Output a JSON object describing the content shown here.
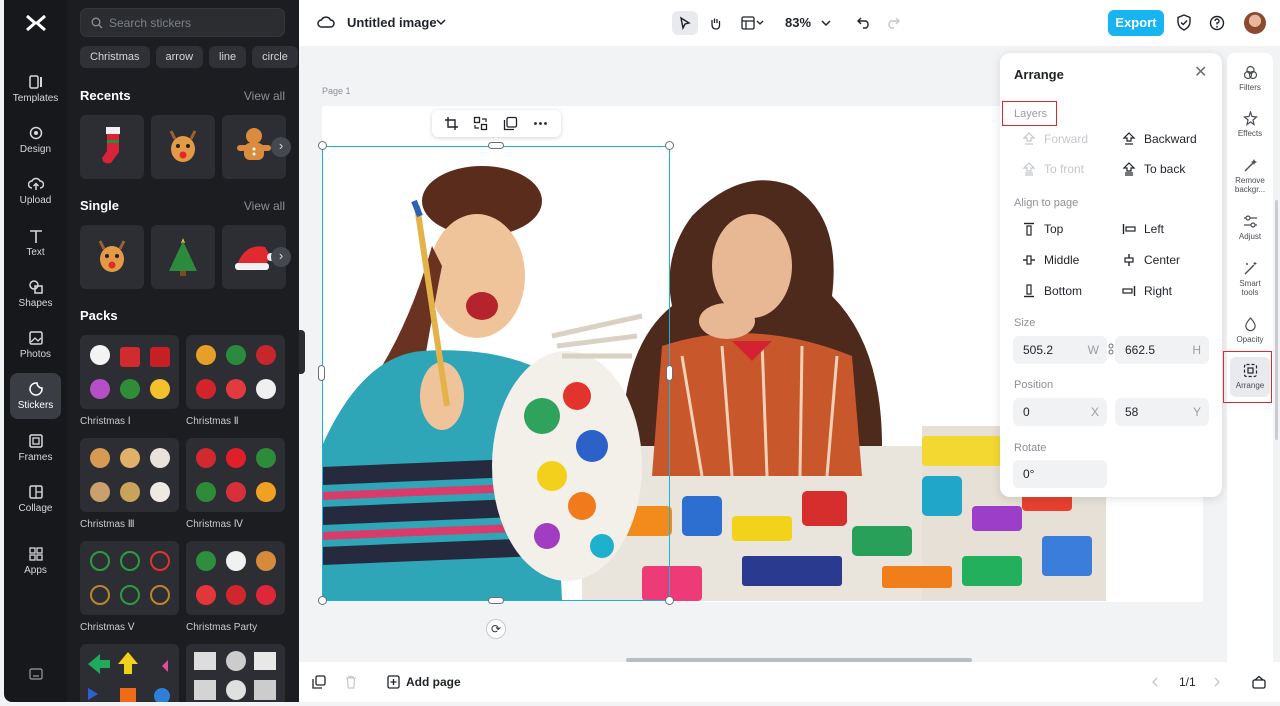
{
  "sidebar": {
    "items": [
      {
        "label": "Templates",
        "icon": "templates-icon"
      },
      {
        "label": "Design",
        "icon": "design-icon"
      },
      {
        "label": "Upload",
        "icon": "upload-icon"
      },
      {
        "label": "Text",
        "icon": "text-icon"
      },
      {
        "label": "Shapes",
        "icon": "shapes-icon"
      },
      {
        "label": "Photos",
        "icon": "photos-icon"
      },
      {
        "label": "Stickers",
        "icon": "stickers-icon",
        "active": true
      },
      {
        "label": "Frames",
        "icon": "frames-icon"
      },
      {
        "label": "Collage",
        "icon": "collage-icon"
      },
      {
        "label": "Apps",
        "icon": "apps-icon"
      }
    ]
  },
  "stickers": {
    "search_placeholder": "Search stickers",
    "chips": [
      "Christmas",
      "arrow",
      "line",
      "circle"
    ],
    "recents_title": "Recents",
    "single_title": "Single",
    "packs_title": "Packs",
    "view_all": "View all",
    "packs": [
      {
        "label": "Christmas Ⅰ"
      },
      {
        "label": "Christmas Ⅱ"
      },
      {
        "label": "Christmas Ⅲ"
      },
      {
        "label": "Christmas Ⅳ"
      },
      {
        "label": "Christmas Ⅴ"
      },
      {
        "label": "Christmas Party"
      }
    ]
  },
  "header": {
    "title": "Untitled image",
    "zoom": "83%",
    "export_label": "Export"
  },
  "canvas": {
    "page_label": "Page 1"
  },
  "arrange": {
    "title": "Arrange",
    "layers_label": "Layers",
    "forward": "Forward",
    "backward": "Backward",
    "to_front": "To front",
    "to_back": "To back",
    "align_label": "Align to page",
    "top": "Top",
    "left": "Left",
    "middle": "Middle",
    "center": "Center",
    "bottom": "Bottom",
    "right": "Right",
    "size_label": "Size",
    "width": "505.2",
    "width_unit": "W",
    "height": "662.5",
    "height_unit": "H",
    "position_label": "Position",
    "x": "0",
    "x_unit": "X",
    "y": "58",
    "y_unit": "Y",
    "rotate_label": "Rotate",
    "rotate": "0°"
  },
  "tools": {
    "items": [
      {
        "label": "Filters"
      },
      {
        "label": "Effects"
      },
      {
        "label": "Remove backgr..."
      },
      {
        "label": "Adjust"
      },
      {
        "label": "Smart tools"
      },
      {
        "label": "Opacity"
      },
      {
        "label": "Arrange",
        "active": true
      }
    ]
  },
  "footer": {
    "add_page": "Add page",
    "pager": "1/1"
  },
  "colors": {
    "accent": "#16b4f0",
    "selection": "#19b3d9",
    "highlight": "#e3262d"
  }
}
